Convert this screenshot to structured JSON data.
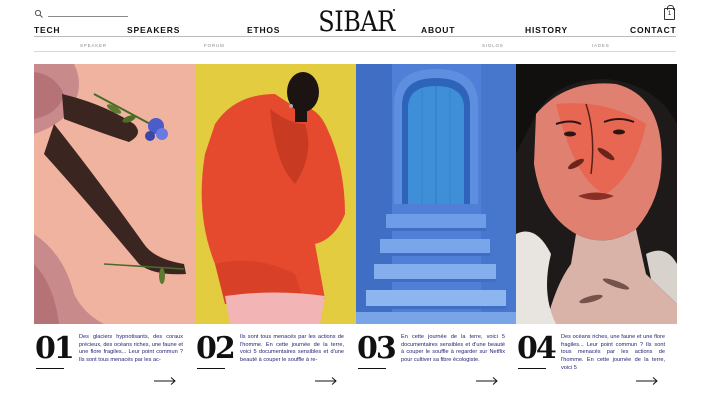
{
  "header": {
    "logo": "SIBAR",
    "search": {
      "icon": "search-icon"
    },
    "cart": {
      "icon": "shopping-bag-icon",
      "count": "1"
    }
  },
  "nav": {
    "items": [
      "TECH",
      "SPEAKERS",
      "ETHOS",
      "ABOUT",
      "HISTORY",
      "CONTACT"
    ]
  },
  "subnav": {
    "items": [
      "SPEAKER",
      "FORUM",
      "SIGLOS",
      "IADES"
    ]
  },
  "panels": [
    {
      "number": "01",
      "text": "Des glaciers hypnotisants, des coraux précieux, des océans riches, une faune et une flore fragiles... Leur point commun ? Ils sont tous menacés par les ac-",
      "arrow_icon": "arrow-right-icon",
      "image": "hand-holding-blue-flowers"
    },
    {
      "number": "02",
      "text": "Ils sont tous menacés par les actions de l'homme. En cette journée de la terre, voici 5 documentaires sensibles et d'une beauté à couper le souffle à re-",
      "arrow_icon": "arrow-right-icon",
      "image": "model-in-red-jacket"
    },
    {
      "number": "03",
      "text": "En cette journée de la terre, voici 5 documentaires sensibles et d'une beauté à couper le souffle à regarder sur Netflix pour cultiver sa fibre écologiste.",
      "arrow_icon": "arrow-right-icon",
      "image": "blue-door-and-stairs"
    },
    {
      "number": "04",
      "text": "Des océans riches, une faune et une flore fragiles... Leur point commun ? Ils sont tous menacés par les actions de l'homme. En cette journée de la terre, voici 5",
      "arrow_icon": "arrow-right-icon",
      "image": "face-with-red-shadow"
    }
  ],
  "colors": {
    "panel1_bg": "#f0b3a0",
    "panel2_bg": "#e3cc3f",
    "panel2_jacket": "#e54a2f",
    "panel3_wall": "#4f7fd6",
    "panel3_door": "#3e8fd8",
    "panel4_bg": "#1e1a1a",
    "panel4_skin": "#e08070",
    "text_blue": "#1d1d70"
  }
}
